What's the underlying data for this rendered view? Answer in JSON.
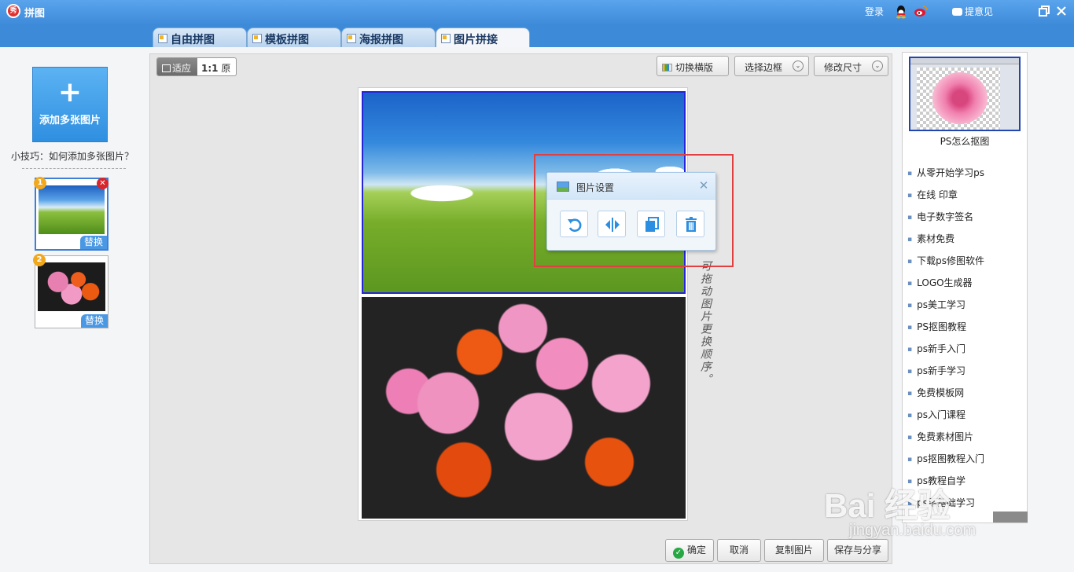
{
  "app": {
    "title": "拼图",
    "logo_text": "秀",
    "login": "登录",
    "feedback": "提意见"
  },
  "tabs": [
    {
      "label": "自由拼图"
    },
    {
      "label": "模板拼图"
    },
    {
      "label": "海报拼图"
    },
    {
      "label": "图片拼接"
    }
  ],
  "left": {
    "add_plus": "+",
    "add_label": "添加多张图片",
    "tip": "小技巧：如何添加多张图片？",
    "thumbs": [
      {
        "num": "1",
        "replace": "替换",
        "delete": "✕"
      },
      {
        "num": "2",
        "replace": "替换"
      }
    ]
  },
  "toolbar": {
    "fit": "适应",
    "orig_prefix": "1:1",
    "orig": "原大",
    "switch_layout": "切换横版",
    "select_border": "选择边框",
    "resize": "修改尺寸",
    "chevron": "⌄"
  },
  "canvas": {
    "hint": "可拖动图片更换顺序。"
  },
  "popup": {
    "title": "图片设置",
    "close": "✕"
  },
  "bottom": {
    "ok": "确定",
    "ok_mark": "✓",
    "cancel": "取消",
    "copy": "复制图片",
    "save": "保存与分享"
  },
  "right": {
    "ad_caption": "PS怎么抠图",
    "links": [
      "从零开始学习ps",
      "在线 印章",
      "电子数字签名",
      "素材免费",
      "下载ps修图软件",
      "LOGO生成器",
      "ps美工学习",
      "PS抠图教程",
      "ps新手入门",
      "ps新手学习",
      "免费模板网",
      "ps入门课程",
      "免费素材图片",
      "ps抠图教程入门",
      "ps教程自学",
      "ps零基础学习"
    ]
  },
  "watermark": {
    "big": "Bai 经验",
    "small": "jingyan.baidu.com"
  },
  "colors": {
    "titlebar": "#3d8ad9",
    "accent": "#2f8fe0",
    "selection_border": "#2424d8",
    "highlight_box": "#e04040"
  }
}
